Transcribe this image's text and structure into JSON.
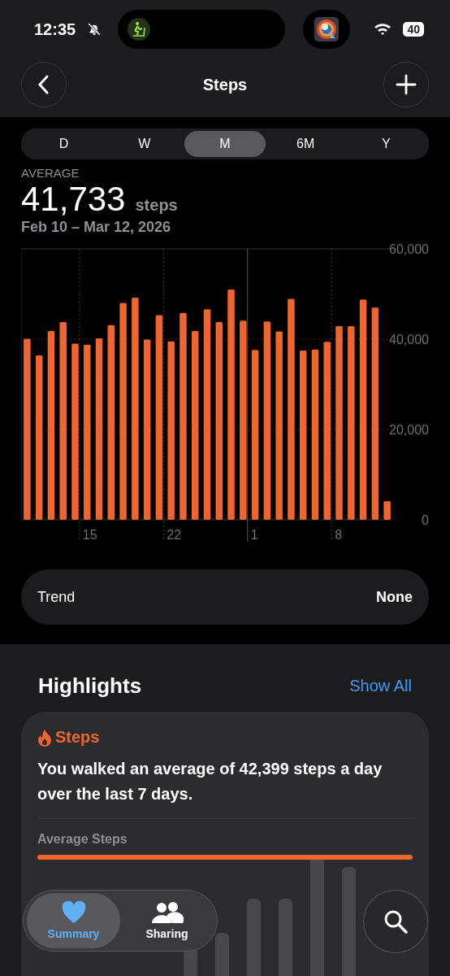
{
  "status_bar": {
    "time": "12:35",
    "battery": "40"
  },
  "nav": {
    "title": "Steps"
  },
  "ranges": [
    {
      "label": "D",
      "selected": false
    },
    {
      "label": "W",
      "selected": false
    },
    {
      "label": "M",
      "selected": true
    },
    {
      "label": "6M",
      "selected": false
    },
    {
      "label": "Y",
      "selected": false
    }
  ],
  "summary": {
    "label": "AVERAGE",
    "value": "41,733",
    "unit": "steps",
    "date_range": "Feb 10 – Mar 12, 2026"
  },
  "chart": {
    "chart_data": {
      "type": "bar",
      "categories": [
        null,
        null,
        null,
        null,
        null,
        "15",
        null,
        null,
        null,
        null,
        null,
        null,
        "22",
        null,
        null,
        null,
        null,
        null,
        null,
        "1",
        null,
        null,
        null,
        null,
        null,
        null,
        "8",
        null,
        null,
        null,
        null
      ],
      "series": [
        {
          "color": "#f0642d",
          "values": [
            40100,
            36400,
            41800,
            43800,
            39000,
            38800,
            40200,
            43100,
            48000,
            49200,
            39900,
            45300,
            39500,
            45800,
            41800,
            46600,
            43800,
            51000,
            44100,
            37600,
            43900,
            41700,
            48900,
            37500,
            37700,
            39400,
            42900,
            42900,
            48800,
            47000,
            4100
          ]
        }
      ],
      "ylim": [
        0,
        60000
      ],
      "grid": true,
      "yticks": [
        {
          "value": 0,
          "label": "0"
        },
        {
          "value": 20000,
          "label": "20,000"
        },
        {
          "value": 40000,
          "label": "40,000"
        },
        {
          "value": 60000,
          "label": "60,000"
        }
      ]
    }
  },
  "trend": {
    "label": "Trend",
    "value": "None"
  },
  "highlights": {
    "title": "Highlights",
    "action": "Show All",
    "card": {
      "category": "Steps",
      "text": "You walked an average of 42,399 steps a day over the last 7 days.",
      "metric": "Average Steps"
    }
  },
  "tabs": [
    {
      "label": "Summary",
      "selected": true
    },
    {
      "label": "Sharing",
      "selected": false
    }
  ]
}
